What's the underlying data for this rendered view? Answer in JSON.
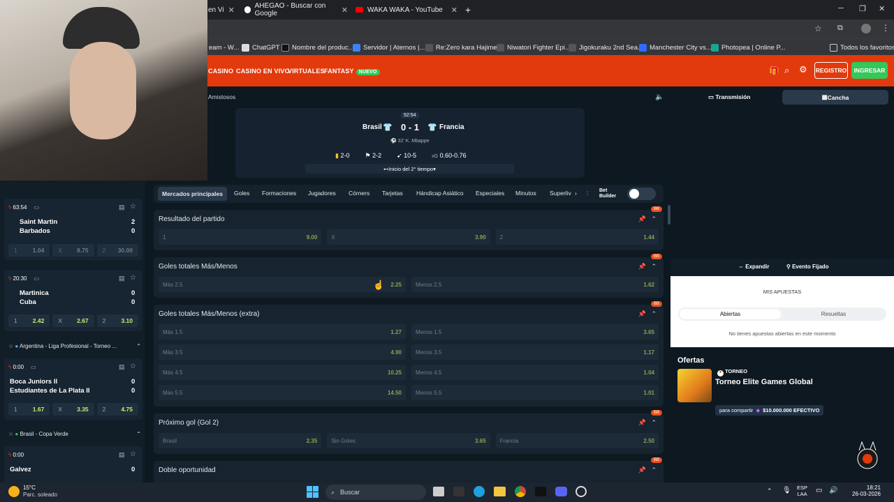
{
  "browser": {
    "tabs": [
      {
        "label": "en Vi"
      },
      {
        "label": "AHEGAO - Buscar con Google"
      },
      {
        "label": "WAKA WAKA - YouTube"
      }
    ],
    "bookmarks": [
      "eam - W...",
      "ChatGPT",
      "Nombre del produc...",
      "Servidor | Aternos |...",
      "Re:Zero kara Hajime...",
      "Niwatori Fighter Epi...",
      "Jigokuraku 2nd Sea...",
      "Manchester City vs...",
      "Photopea | Online P...",
      "Todos los favoritos"
    ]
  },
  "site": {
    "nav": [
      "CASINO",
      "CASINO EN VIVO",
      "VIRTUALES",
      "FANTASY"
    ],
    "new_badge": "NUEVO",
    "registro": "REGISTRO",
    "ingresar": "INGRESAR",
    "accent": "#e23a0d"
  },
  "breadcrumb": "Amistosos",
  "right_tabs": {
    "transmision": "Transmisión",
    "cancha": "Cancha"
  },
  "scoreboard": {
    "minute": "52:54",
    "home": "Brasil",
    "score": "0 - 1",
    "away": "Francia",
    "event": "32' K. Mbappe",
    "stats": [
      {
        "icon": "card-icon",
        "value": "2-0"
      },
      {
        "icon": "corner-icon",
        "value": "2-2"
      },
      {
        "icon": "shot-icon",
        "value": "10-5"
      },
      {
        "label": "xG",
        "value": "0.60-0.76"
      }
    ],
    "period": "Inicio del 2° tiempo"
  },
  "market_tabs": [
    "Mercados principales",
    "Goles",
    "Formaciones",
    "Jugadores",
    "Córners",
    "Tarjetas",
    "Hándicap Asiático",
    "Especiales",
    "Minutos",
    "Superliv"
  ],
  "bet_builder": "Bet Builder",
  "markets": [
    {
      "title": "Resultado del partido",
      "rows": [
        [
          {
            "k": "1",
            "v": "9.00"
          },
          {
            "k": "X",
            "v": "3.90"
          },
          {
            "k": "2",
            "v": "1.44"
          }
        ]
      ]
    },
    {
      "title": "Goles totales Más/Menos",
      "rows": [
        [
          {
            "k": "Más 2.5",
            "v": "2.25"
          },
          {
            "k": "Menos 2.5",
            "v": "1.62"
          }
        ]
      ]
    },
    {
      "title": "Goles totales Más/Menos (extra)",
      "rows": [
        [
          {
            "k": "Más 1.5",
            "v": "1.27"
          },
          {
            "k": "Menos 1.5",
            "v": "3.65"
          }
        ],
        [
          {
            "k": "Más 3.5",
            "v": "4.90"
          },
          {
            "k": "Menos 3.5",
            "v": "1.17"
          }
        ],
        [
          {
            "k": "Más 4.5",
            "v": "10.25"
          },
          {
            "k": "Menos 4.5",
            "v": "1.04"
          }
        ],
        [
          {
            "k": "Más 5.5",
            "v": "14.50"
          },
          {
            "k": "Menos 5.5",
            "v": "1.01"
          }
        ]
      ]
    },
    {
      "title": "Próximo gol (Gol 2)",
      "rows": [
        [
          {
            "k": "Brasil",
            "v": "2.35"
          },
          {
            "k": "Sin Goles",
            "v": "3.65"
          },
          {
            "k": "Francia",
            "v": "2.50"
          }
        ]
      ]
    },
    {
      "title": "Doble oportunidad",
      "rows": []
    }
  ],
  "market_badge": "BB",
  "sidebar": {
    "matches": [
      {
        "time": "63:54",
        "home": "Saint Martin",
        "away": "Barbados",
        "hs": "2",
        "as": "0",
        "odds": [
          [
            "1",
            "1.04"
          ],
          [
            "X",
            "8.75"
          ],
          [
            "2",
            "30.00"
          ]
        ],
        "dim": true
      },
      {
        "time": "20:30",
        "home": "Martinica",
        "away": "Cuba",
        "hs": "0",
        "as": "0",
        "odds": [
          [
            "1",
            "2.42"
          ],
          [
            "X",
            "2.67"
          ],
          [
            "2",
            "3.10"
          ]
        ],
        "dim": false
      },
      {
        "time": "0:00",
        "home": "Boca Juniors II",
        "away": "Estudiantes de La Plata II",
        "hs": "0",
        "as": "0",
        "odds": [
          [
            "1",
            "1.67"
          ],
          [
            "X",
            "3.35"
          ],
          [
            "2",
            "4.75"
          ]
        ],
        "dim": false
      },
      {
        "time": "0:00",
        "home": "Galvez",
        "away": "",
        "hs": "0",
        "as": "",
        "odds": [],
        "dim": false
      }
    ],
    "leagues": [
      "Argentina - Liga Profesional - Torneo ...",
      "Brasil - Copa Verde"
    ]
  },
  "betslip": {
    "expand": "Expandir",
    "fixed": "Evento Fijado",
    "title": "MIS APUESTAS",
    "open": "Abiertas",
    "resolved": "Resueltas",
    "empty": "No tienes apuestas abiertas en este momento"
  },
  "offers": {
    "title": "Ofertas",
    "tag": "TORNEO",
    "name": "Torneo Elite Games Global",
    "share": "para compartir",
    "prize": "$10.000.000 EFECTIVO"
  },
  "taskbar": {
    "temp": "15°C",
    "weather": "Parc. soleado",
    "search": "Buscar",
    "lang1": "ESP",
    "lang2": "LAA",
    "time": "18:21",
    "date": "26-03-2026"
  }
}
